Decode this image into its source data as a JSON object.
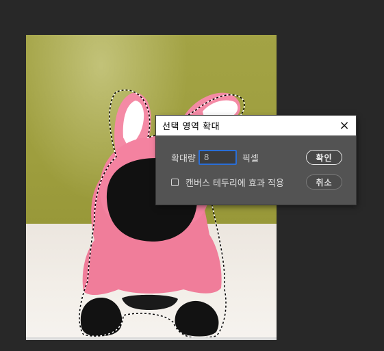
{
  "dialog": {
    "title": "선택 영역 확대",
    "close_icon": "×",
    "expand_label": "확대량",
    "expand_value": "8",
    "unit_label": "픽셀",
    "apply_canvas_label": "캔버스 테두리에 효과 적용",
    "apply_canvas_checked": false,
    "ok_label": "확인",
    "cancel_label": "취소"
  },
  "colors": {
    "workspace_bg": "#282828",
    "dialog_bg": "#535353",
    "input_focus_border": "#2a6ed6"
  }
}
